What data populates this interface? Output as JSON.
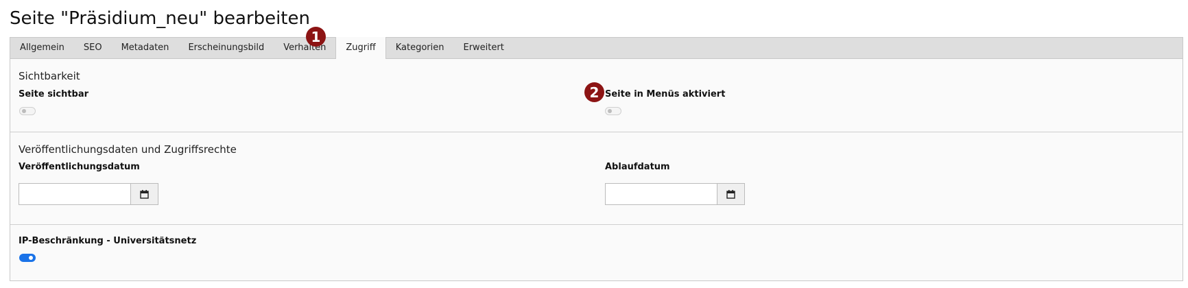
{
  "page": {
    "title": "Seite \"Präsidium_neu\" bearbeiten"
  },
  "tabs": [
    {
      "label": "Allgemein",
      "active": false
    },
    {
      "label": "SEO",
      "active": false
    },
    {
      "label": "Metadaten",
      "active": false
    },
    {
      "label": "Erscheinungsbild",
      "active": false
    },
    {
      "label": "Verhalten",
      "active": false
    },
    {
      "label": "Zugriff",
      "active": true
    },
    {
      "label": "Kategorien",
      "active": false
    },
    {
      "label": "Erweitert",
      "active": false
    }
  ],
  "sections": {
    "visibility": {
      "title": "Sichtbarkeit",
      "page_visible": {
        "label": "Seite sichtbar",
        "enabled": false
      },
      "in_menus": {
        "label": "Seite in Menüs aktiviert",
        "enabled": false
      }
    },
    "publishing": {
      "title": "Veröffentlichungsdaten und Zugriffsrechte",
      "publish_date": {
        "label": "Veröffentlichungsdatum",
        "value": "",
        "icon": "calendar-icon"
      },
      "expiry_date": {
        "label": "Ablaufdatum",
        "value": "",
        "icon": "calendar-icon"
      }
    },
    "ip_restriction": {
      "label": "IP-Beschränkung - Universitätsnetz",
      "enabled": true
    }
  },
  "markers": {
    "m1": "1",
    "m2": "2"
  },
  "colors": {
    "marker": "#8c1414",
    "toggle_on": "#1a73e8"
  }
}
